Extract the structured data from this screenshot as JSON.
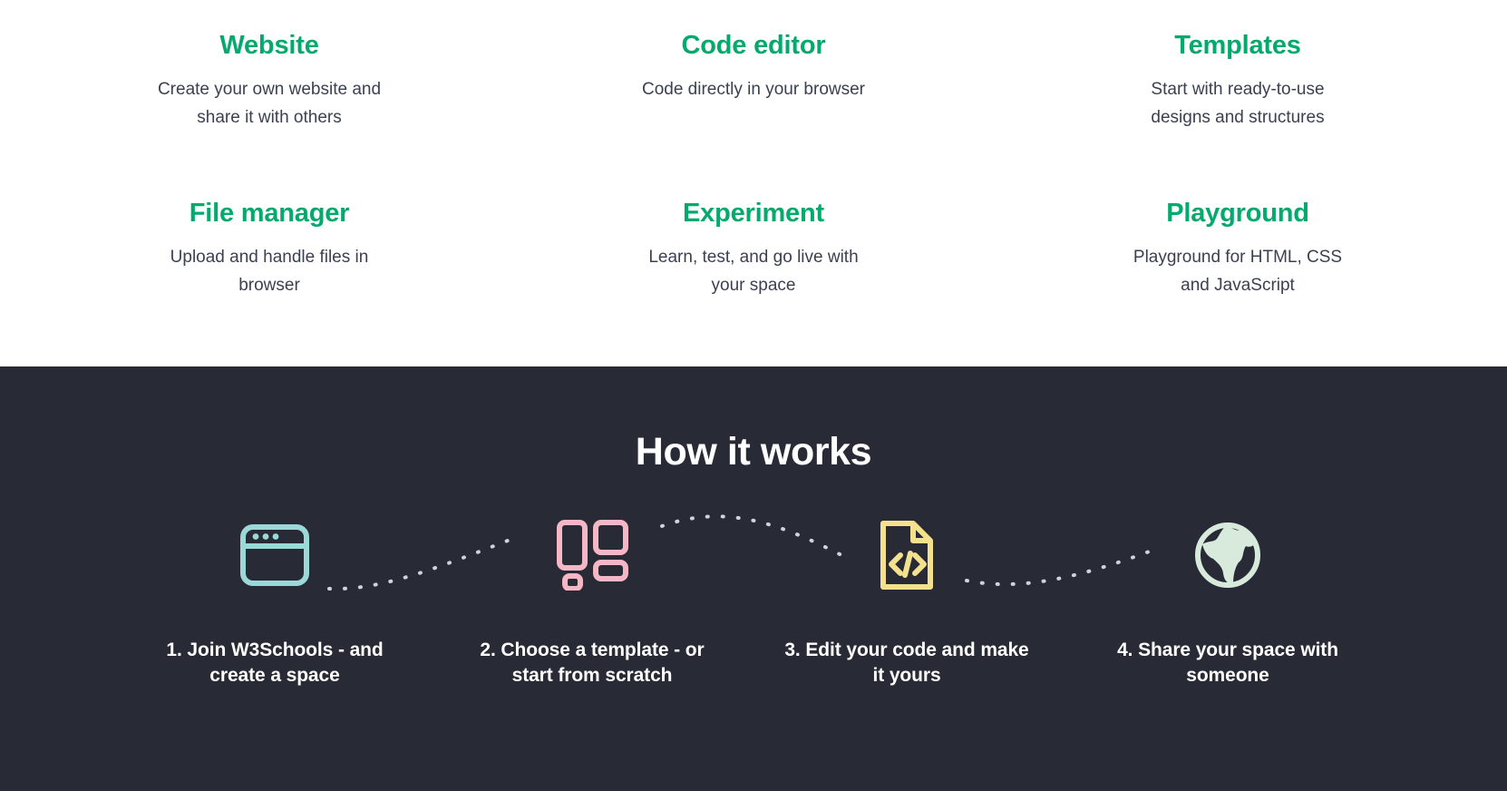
{
  "features": {
    "accent_color": "#04AA6D",
    "items": [
      {
        "title": "Website",
        "desc": "Create your own website and share it with others"
      },
      {
        "title": "Code editor",
        "desc": "Code directly in your browser"
      },
      {
        "title": "Templates",
        "desc": "Start with ready-to-use designs and structures"
      },
      {
        "title": "File manager",
        "desc": "Upload and handle files in browser"
      },
      {
        "title": "Experiment",
        "desc": "Learn, test, and go live with your space"
      },
      {
        "title": "Playground",
        "desc": "Playground for HTML, CSS and JavaScript"
      }
    ]
  },
  "how_it_works": {
    "background_color": "#282A35",
    "title": "How it works",
    "steps": [
      {
        "label": "1. Join W3Schools - and create a space",
        "icon": "browser-window-icon",
        "icon_color": "#9BD8D8"
      },
      {
        "label": "2. Choose a template - or start from scratch",
        "icon": "layout-template-icon",
        "icon_color": "#F5B7C6"
      },
      {
        "label": "3. Edit your code and make it yours",
        "icon": "code-file-icon",
        "icon_color": "#F4E18E"
      },
      {
        "label": "4. Share your space with someone",
        "icon": "globe-icon",
        "icon_color": "#D7EADB"
      }
    ],
    "connector_color": "#cfd3da"
  }
}
